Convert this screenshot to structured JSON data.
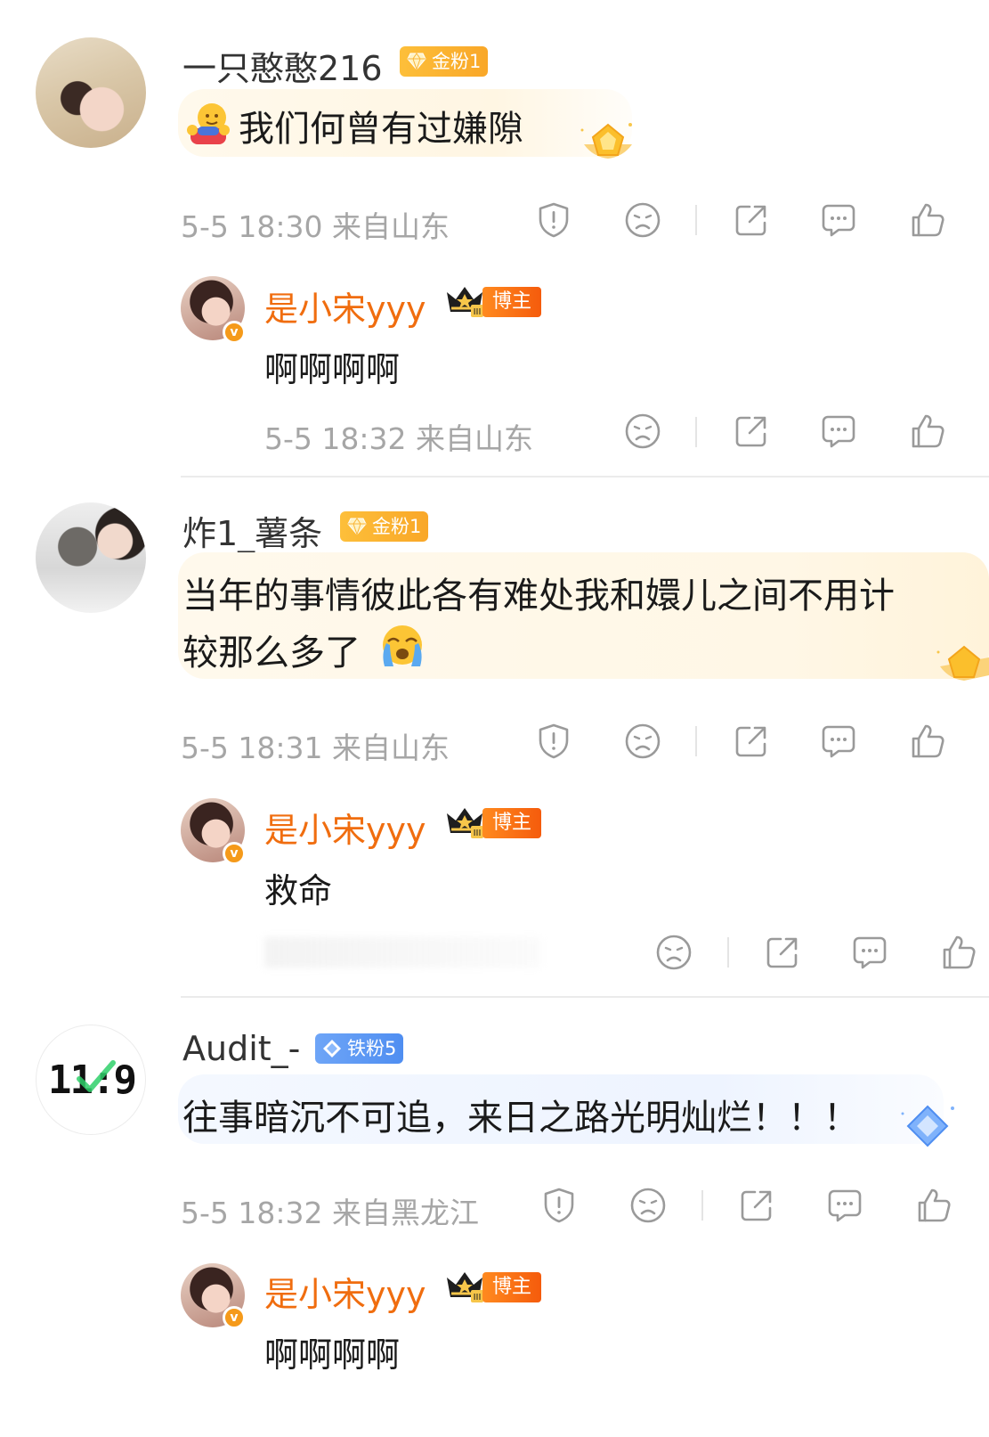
{
  "comments": [
    {
      "user": "一只憨憨216",
      "fan_badge": "金粉1",
      "text": "我们何曾有过嫌隙",
      "meta": "5-5 18:30  来自山东",
      "reply": {
        "user": "是小宋yyy",
        "role_badge": "博主",
        "text": "啊啊啊啊",
        "meta": "5-5 18:32  来自山东"
      }
    },
    {
      "user": "炸1_薯条",
      "fan_badge": "金粉1",
      "text_line1": "当年的事情彼此各有难处我和嬛儿之间不用计",
      "text_line2": "较那么多了",
      "meta": "5-5 18:31  来自山东",
      "reply": {
        "user": "是小宋yyy",
        "role_badge": "博主",
        "text": "救命"
      }
    },
    {
      "user": "Audit_-",
      "avatar_text": "11:9",
      "fan_badge": "铁粉5",
      "text": "往事暗沉不可追，来日之路光明灿烂！！！",
      "meta": "5-5 18:32  来自黑龙江",
      "reply": {
        "user": "是小宋yyy",
        "role_badge": "博主",
        "text": "啊啊啊啊"
      }
    }
  ],
  "colors": {
    "username": "#333333",
    "blogger_name": "#f06d0f",
    "meta": "#a6a6a6",
    "gold_badge": "#fdb330",
    "iron_badge": "#5b97f3",
    "blogger_tag": "#f86d14"
  },
  "icons": [
    "shield-report-icon",
    "dislike-face-icon",
    "share-icon",
    "comment-icon",
    "like-thumb-icon",
    "hug-emoji-icon",
    "crying-emoji-icon",
    "crown-icon",
    "verified-badge-icon",
    "gold-gem-icon",
    "diamond-icon"
  ]
}
